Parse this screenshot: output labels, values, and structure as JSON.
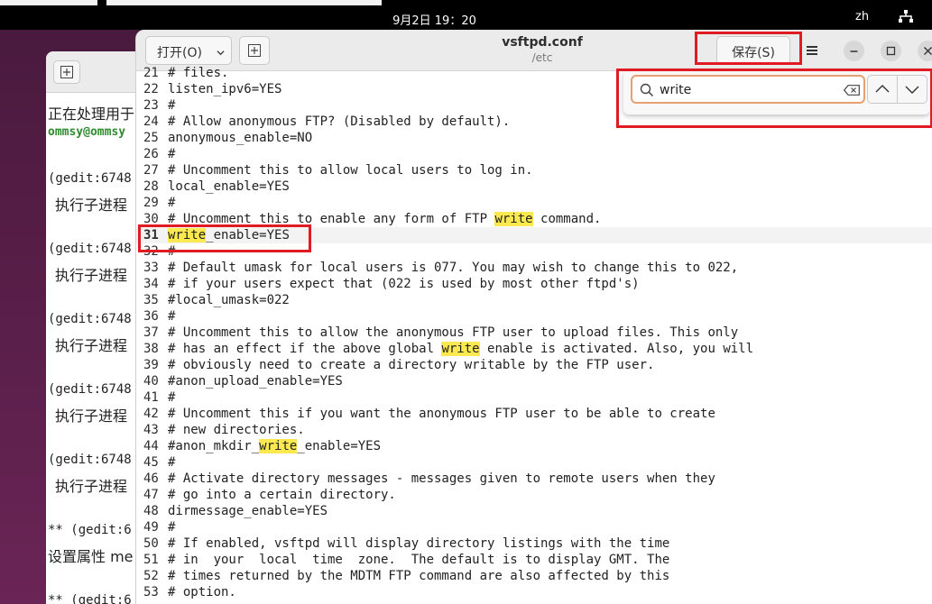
{
  "topbar": {
    "datetime": "9月2日  19：20",
    "language": "zh",
    "network_icon": "network-icon"
  },
  "terminal": {
    "lines": [
      "正在处理用于",
      "ommsy@ommsy",
      "(gedit:6748",
      "执行子进程",
      "(gedit:6748",
      "执行子进程",
      "(gedit:6748",
      "执行子进程",
      "(gedit:6748",
      "执行子进程",
      "(gedit:6748",
      "执行子进程",
      "** (gedit:6",
      "设置属性 me",
      "** (gedit:6"
    ]
  },
  "gedit": {
    "open_label": "打开(O)",
    "title": "vsftpd.conf",
    "subtitle": "/etc",
    "save_label": "保存(S)",
    "search": {
      "value": "write",
      "placeholder": ""
    },
    "highlight_color": "#fce94f",
    "annotation_color": "#e01b24",
    "lines": [
      {
        "n": "21",
        "text": "# files."
      },
      {
        "n": "22",
        "text": "listen_ipv6=YES"
      },
      {
        "n": "23",
        "text": "#"
      },
      {
        "n": "24",
        "text": "# Allow anonymous FTP? (Disabled by default)."
      },
      {
        "n": "25",
        "text": "anonymous_enable=NO"
      },
      {
        "n": "26",
        "text": "#"
      },
      {
        "n": "27",
        "text": "# Uncomment this to allow local users to log in."
      },
      {
        "n": "28",
        "text": "local_enable=YES"
      },
      {
        "n": "29",
        "text": "#"
      },
      {
        "n": "30",
        "text": "# Uncomment this to enable any form of FTP write command."
      },
      {
        "n": "31",
        "text": "write_enable=YES"
      },
      {
        "n": "32",
        "text": "#"
      },
      {
        "n": "33",
        "text": "# Default umask for local users is 077. You may wish to change this to 022,"
      },
      {
        "n": "34",
        "text": "# if your users expect that (022 is used by most other ftpd's)"
      },
      {
        "n": "35",
        "text": "#local_umask=022"
      },
      {
        "n": "36",
        "text": "#"
      },
      {
        "n": "37",
        "text": "# Uncomment this to allow the anonymous FTP user to upload files. This only"
      },
      {
        "n": "38",
        "text": "# has an effect if the above global write enable is activated. Also, you will"
      },
      {
        "n": "39",
        "text": "# obviously need to create a directory writable by the FTP user."
      },
      {
        "n": "40",
        "text": "#anon_upload_enable=YES"
      },
      {
        "n": "41",
        "text": "#"
      },
      {
        "n": "42",
        "text": "# Uncomment this if you want the anonymous FTP user to be able to create"
      },
      {
        "n": "43",
        "text": "# new directories."
      },
      {
        "n": "44",
        "text": "#anon_mkdir_write_enable=YES"
      },
      {
        "n": "45",
        "text": "#"
      },
      {
        "n": "46",
        "text": "# Activate directory messages - messages given to remote users when they"
      },
      {
        "n": "47",
        "text": "# go into a certain directory."
      },
      {
        "n": "48",
        "text": "dirmessage_enable=YES"
      },
      {
        "n": "49",
        "text": "#"
      },
      {
        "n": "50",
        "text": "# If enabled, vsftpd will display directory listings with the time"
      },
      {
        "n": "51",
        "text": "# in  your  local  time  zone.  The default is to display GMT. The"
      },
      {
        "n": "52",
        "text": "# times returned by the MDTM FTP command are also affected by this"
      },
      {
        "n": "53",
        "text": "# option."
      }
    ]
  }
}
